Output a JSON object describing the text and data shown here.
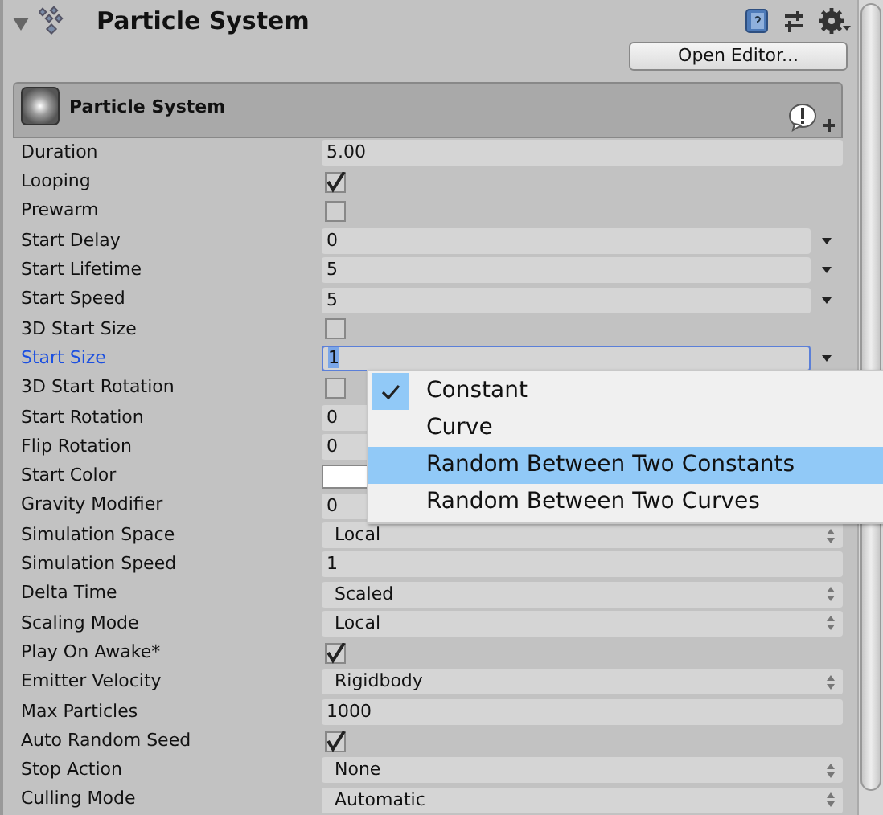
{
  "header": {
    "title": "Particle System",
    "open_editor": "Open Editor..."
  },
  "module": {
    "title": "Particle System"
  },
  "properties": [
    {
      "label": "Duration",
      "kind": "float",
      "value": "5.00",
      "focused": false
    },
    {
      "label": "Looping",
      "kind": "checkbox",
      "checked": true,
      "focused": false
    },
    {
      "label": "Prewarm",
      "kind": "checkbox",
      "checked": false,
      "focused": false
    },
    {
      "label": "Start Delay",
      "kind": "curve",
      "value": "0",
      "focused": false
    },
    {
      "label": "Start Lifetime",
      "kind": "curve",
      "value": "5",
      "focused": false
    },
    {
      "label": "Start Speed",
      "kind": "curve",
      "value": "5",
      "focused": false
    },
    {
      "label": "3D Start Size",
      "kind": "checkbox",
      "checked": false,
      "focused": false
    },
    {
      "label": "Start Size",
      "kind": "curve",
      "value": "1",
      "focused": true
    },
    {
      "label": "3D Start Rotation",
      "kind": "checkbox",
      "checked": false,
      "focused": false
    },
    {
      "label": "Start Rotation",
      "kind": "curve",
      "value": "0",
      "focused": false
    },
    {
      "label": "Flip Rotation",
      "kind": "float",
      "value": "0",
      "focused": false
    },
    {
      "label": "Start Color",
      "kind": "color",
      "color": "#ffffff",
      "focused": false
    },
    {
      "label": "Gravity Modifier",
      "kind": "curve",
      "value": "0",
      "focused": false
    },
    {
      "label": "Simulation Space",
      "kind": "enum",
      "value": "Local",
      "focused": false
    },
    {
      "label": "Simulation Speed",
      "kind": "float",
      "value": "1",
      "focused": false
    },
    {
      "label": "Delta Time",
      "kind": "enum",
      "value": "Scaled",
      "focused": false
    },
    {
      "label": "Scaling Mode",
      "kind": "enum",
      "value": "Local",
      "focused": false
    },
    {
      "label": "Play On Awake*",
      "kind": "checkbox",
      "checked": true,
      "focused": false
    },
    {
      "label": "Emitter Velocity",
      "kind": "enum",
      "value": "Rigidbody",
      "focused": false
    },
    {
      "label": "Max Particles",
      "kind": "float",
      "value": "1000",
      "focused": false
    },
    {
      "label": "Auto Random Seed",
      "kind": "checkbox",
      "checked": true,
      "focused": false
    },
    {
      "label": "Stop Action",
      "kind": "enum",
      "value": "None",
      "focused": false
    },
    {
      "label": "Culling Mode",
      "kind": "enum",
      "value": "Automatic",
      "focused": false
    }
  ],
  "popup": {
    "items": [
      {
        "label": "Constant",
        "checked": true,
        "selected": false
      },
      {
        "label": "Curve",
        "checked": false,
        "selected": false
      },
      {
        "label": "Random Between Two Constants",
        "checked": false,
        "selected": true
      },
      {
        "label": "Random Between Two Curves",
        "checked": false,
        "selected": false
      }
    ]
  }
}
